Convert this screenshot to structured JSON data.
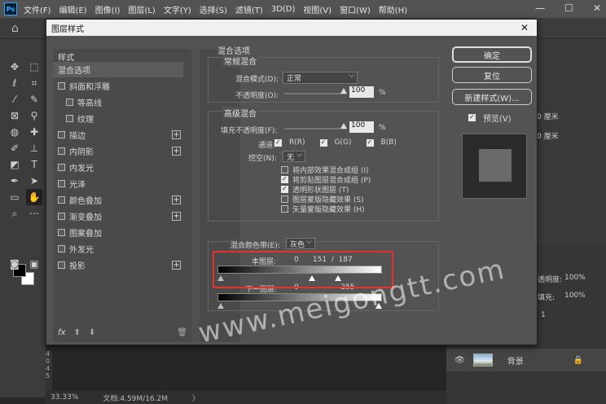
{
  "app": {
    "logo": "Ps",
    "menu": [
      "文件(F)",
      "编辑(E)",
      "图像(I)",
      "图层(L)",
      "文字(Y)",
      "选择(S)",
      "滤镜(T)",
      "3D(D)",
      "视图(V)",
      "窗口(W)",
      "帮助(H)"
    ],
    "win_min": "—",
    "win_max": "☐",
    "win_close": "✕"
  },
  "dialog": {
    "title": "图层样式",
    "close": "✕",
    "styles_header": "样式",
    "style_items": [
      {
        "label": "混合选项",
        "checkbox": false,
        "plus": false,
        "selected": true
      },
      {
        "label": "斜面和浮雕",
        "checkbox": true,
        "plus": false
      },
      {
        "label": "等高线",
        "checkbox": true,
        "plus": false,
        "indent": true
      },
      {
        "label": "纹理",
        "checkbox": true,
        "plus": false,
        "indent": true
      },
      {
        "label": "描边",
        "checkbox": true,
        "plus": true
      },
      {
        "label": "内阴影",
        "checkbox": true,
        "plus": true
      },
      {
        "label": "内发光",
        "checkbox": true,
        "plus": false
      },
      {
        "label": "光泽",
        "checkbox": true,
        "plus": false
      },
      {
        "label": "颜色叠加",
        "checkbox": true,
        "plus": true
      },
      {
        "label": "渐变叠加",
        "checkbox": true,
        "plus": true
      },
      {
        "label": "图案叠加",
        "checkbox": true,
        "plus": false
      },
      {
        "label": "外发光",
        "checkbox": true,
        "plus": false
      },
      {
        "label": "投影",
        "checkbox": true,
        "plus": true
      }
    ],
    "fx_label": "fx",
    "blend_options": {
      "title": "混合选项",
      "general_title": "常规混合",
      "blend_mode_label": "混合模式(D):",
      "blend_mode_value": "正常",
      "opacity_label": "不透明度(O):",
      "opacity_value": "100",
      "percent": "%",
      "advanced_title": "高级混合",
      "fill_opacity_label": "填充不透明度(F):",
      "fill_opacity_value": "100",
      "channels_label": "通道:",
      "channel_r": "R(R)",
      "channel_g": "G(G)",
      "channel_b": "B(B)",
      "knockout_label": "挖空(N):",
      "knockout_value": "无",
      "checks": [
        {
          "label": "将内部效果混合成组 (I)",
          "checked": false
        },
        {
          "label": "将剪贴图层混合成组 (P)",
          "checked": true
        },
        {
          "label": "透明形状图层 (T)",
          "checked": true
        },
        {
          "label": "图层蒙版隐藏效果 (S)",
          "checked": false
        },
        {
          "label": "矢量蒙版隐藏效果 (H)",
          "checked": false
        }
      ],
      "blend_if_label": "混合颜色带(E):",
      "blend_if_value": "灰色",
      "this_layer_label": "本图层:",
      "this_layer_values": "0      151  /  187",
      "underlying_label": "下一图层:",
      "underlying_values": "0                  255"
    },
    "buttons": {
      "ok": "确定",
      "reset": "复位",
      "new_style": "新建样式(W)...",
      "preview": "预览(V)"
    }
  },
  "status": {
    "zoom": "33.33%",
    "doc": "文档:4.59M/16.2M",
    "arrow": "〉"
  },
  "right_panel": {
    "width_field": "0 厘米",
    "height_field": "0 厘米",
    "opacity_label": "透明度:",
    "opacity_val": "100%",
    "fill_label": "填充:",
    "fill_val": "100%",
    "layer_name": "背景",
    "one": "1"
  },
  "watermark": "www.meigongtt.com",
  "ruler_digits": [
    "4",
    "0",
    "4",
    "5"
  ]
}
